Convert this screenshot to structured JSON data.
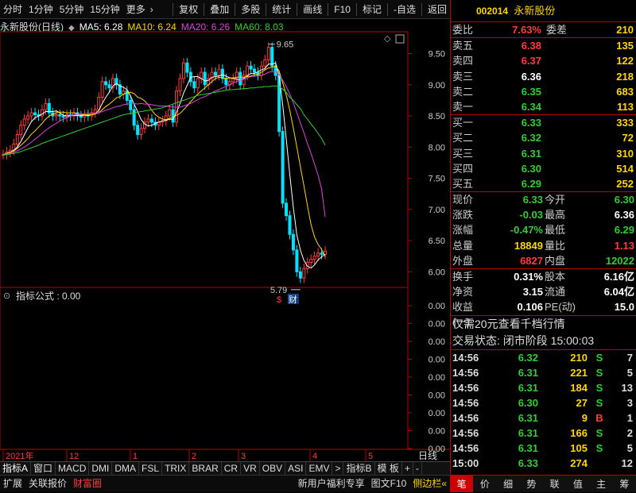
{
  "toolbar": {
    "items": [
      "分时",
      "1分钟",
      "5分钟",
      "15分钟",
      "更多"
    ],
    "more_arrow": "›",
    "right": [
      "复权",
      "叠加",
      "多股",
      "统计",
      "画线",
      "F10",
      "标记",
      "-自选",
      "返回"
    ]
  },
  "chart": {
    "title": "永新股份(日线)",
    "ma": [
      {
        "label": "MA5: 6.28",
        "color": "#ffffff"
      },
      {
        "label": "MA10: 6.24",
        "color": "#ffd700"
      },
      {
        "label": "MA20: 6.26",
        "color": "#e040e0"
      },
      {
        "label": "MA60: 8.03",
        "color": "#32cd32"
      }
    ],
    "high_label": "9.65",
    "low_label": "5.79",
    "marker_s": "$",
    "marker_cai": "财",
    "indicator_label": "指标公式 : 0.00"
  },
  "chart_data": {
    "type": "candlestick",
    "y_ticks": [
      "9.50",
      "9.00",
      "8.50",
      "8.00",
      "7.50",
      "7.00",
      "6.50",
      "6.00"
    ],
    "ylim": [
      5.75,
      9.85
    ],
    "indicator_ticks": [
      "0.00",
      "0.00",
      "0.00",
      "0.00",
      "0.00",
      "0.00",
      "0.00",
      "0.00",
      "0.00"
    ],
    "x_labels": [
      "2021年",
      "12",
      "1",
      "2",
      "3",
      "4",
      "5"
    ],
    "right_axis_label": "日线",
    "close": [
      7.88,
      7.92,
      7.95,
      8.05,
      8.2,
      8.35,
      8.45,
      8.5,
      8.55,
      8.52,
      8.5,
      8.6,
      8.7,
      8.55,
      8.5,
      8.52,
      8.5,
      8.48,
      8.52,
      8.5,
      8.55,
      8.5,
      8.48,
      8.52,
      8.5,
      8.55,
      8.6,
      8.8,
      9.05,
      9.0,
      8.95,
      9.1,
      9.0,
      8.85,
      8.9,
      8.75,
      8.6,
      8.35,
      8.2,
      8.3,
      8.4,
      8.45,
      8.4,
      8.35,
      8.4,
      8.42,
      8.5,
      8.6,
      8.4,
      8.9,
      9.1,
      9.35,
      9.2,
      9.05,
      8.95,
      9.1,
      9.2,
      9.0,
      9.1,
      9.2,
      9.15,
      9.25,
      9.1,
      9.0,
      9.05,
      9.1,
      9.2,
      9.0,
      9.15,
      9.3,
      9.25,
      9.2,
      9.15,
      9.3,
      9.4,
      9.6,
      9.3,
      9.15,
      8.25,
      7.1,
      6.9,
      6.6,
      6.35,
      6.0,
      5.9,
      6.05,
      6.15,
      6.2,
      6.25,
      6.3,
      6.28,
      6.33
    ],
    "ma_series": {
      "ma5": [
        7.88,
        7.9,
        7.92,
        7.95,
        8.0,
        8.09,
        8.2,
        8.31,
        8.41,
        8.47,
        8.5,
        8.53,
        8.57,
        8.57,
        8.57,
        8.58,
        8.55,
        8.51,
        8.5,
        8.5,
        8.51,
        8.51,
        8.51,
        8.51,
        8.51,
        8.52,
        8.53,
        8.59,
        8.7,
        8.8,
        8.88,
        8.98,
        9.02,
        8.98,
        8.96,
        8.92,
        8.82,
        8.69,
        8.57,
        8.44,
        8.37,
        8.34,
        8.35,
        8.38,
        8.4,
        8.42,
        8.43,
        8.45,
        8.44,
        8.56,
        8.7,
        8.87,
        8.99,
        9.12,
        9.13,
        9.13,
        9.1,
        9.06,
        9.07,
        9.12,
        9.13,
        9.14,
        9.16,
        9.14,
        9.11,
        9.1,
        9.09,
        9.07,
        9.1,
        9.15,
        9.18,
        9.18,
        9.21,
        9.24,
        9.26,
        9.33,
        9.33,
        9.35,
        9.14,
        8.68,
        8.14,
        7.56,
        7.04,
        6.59,
        6.35,
        6.18,
        6.09,
        6.06,
        6.11,
        6.19,
        6.24,
        6.28
      ],
      "ma10": [
        7.88,
        7.9,
        7.92,
        7.94,
        7.98,
        8.03,
        8.08,
        8.14,
        8.21,
        8.26,
        8.32,
        8.38,
        8.45,
        8.5,
        8.53,
        8.55,
        8.56,
        8.56,
        8.55,
        8.55,
        8.55,
        8.54,
        8.52,
        8.52,
        8.52,
        8.52,
        8.53,
        8.55,
        8.6,
        8.65,
        8.69,
        8.74,
        8.79,
        8.81,
        8.85,
        8.87,
        8.88,
        8.86,
        8.8,
        8.78,
        8.74,
        8.68,
        8.59,
        8.52,
        8.48,
        8.45,
        8.44,
        8.46,
        8.48,
        8.51,
        8.54,
        8.6,
        8.66,
        8.73,
        8.79,
        8.85,
        8.9,
        8.95,
        9.0,
        9.05,
        9.1,
        9.12,
        9.11,
        9.1,
        9.11,
        9.11,
        9.12,
        9.12,
        9.12,
        9.13,
        9.14,
        9.16,
        9.17,
        9.2,
        9.24,
        9.27,
        9.28,
        9.3,
        9.22,
        9.03,
        8.84,
        8.59,
        8.31,
        8.0,
        7.69,
        7.38,
        7.06,
        6.76,
        6.56,
        6.44,
        6.36,
        6.24
      ],
      "ma20": [
        7.88,
        7.89,
        7.9,
        7.92,
        7.94,
        7.97,
        8.0,
        8.04,
        8.08,
        8.13,
        8.17,
        8.22,
        8.27,
        8.31,
        8.35,
        8.38,
        8.42,
        8.45,
        8.47,
        8.5,
        8.52,
        8.53,
        8.53,
        8.54,
        8.54,
        8.54,
        8.54,
        8.55,
        8.57,
        8.59,
        8.61,
        8.63,
        8.65,
        8.66,
        8.68,
        8.69,
        8.7,
        8.7,
        8.69,
        8.7,
        8.69,
        8.69,
        8.68,
        8.67,
        8.66,
        8.66,
        8.66,
        8.65,
        8.64,
        8.64,
        8.64,
        8.66,
        8.68,
        8.7,
        8.73,
        8.76,
        8.79,
        8.81,
        8.84,
        8.87,
        8.9,
        8.92,
        8.95,
        8.97,
        9.0,
        9.03,
        9.05,
        9.07,
        9.09,
        9.11,
        9.13,
        9.14,
        9.14,
        9.15,
        9.17,
        9.2,
        9.21,
        9.21,
        9.16,
        9.07,
        8.97,
        8.85,
        8.71,
        8.55,
        8.39,
        8.23,
        8.06,
        7.9,
        7.73,
        7.55,
        7.33,
        6.88
      ],
      "ma60": [
        7.88,
        7.88,
        7.89,
        7.9,
        7.91,
        7.93,
        7.95,
        7.97,
        7.99,
        8.01,
        8.03,
        8.06,
        8.08,
        8.1,
        8.12,
        8.14,
        8.16,
        8.18,
        8.2,
        8.22,
        8.24,
        8.26,
        8.28,
        8.3,
        8.32,
        8.34,
        8.36,
        8.38,
        8.4,
        8.42,
        8.44,
        8.46,
        8.48,
        8.5,
        8.52,
        8.53,
        8.54,
        8.55,
        8.56,
        8.57,
        8.58,
        8.59,
        8.6,
        8.61,
        8.62,
        8.63,
        8.65,
        8.67,
        8.69,
        8.71,
        8.73,
        8.75,
        8.77,
        8.79,
        8.81,
        8.83,
        8.84,
        8.85,
        8.86,
        8.87,
        8.88,
        8.89,
        8.9,
        8.91,
        8.92,
        8.92,
        8.93,
        8.93,
        8.94,
        8.94,
        8.95,
        8.95,
        8.96,
        8.96,
        8.97,
        8.97,
        8.98,
        8.98,
        8.97,
        8.93,
        8.88,
        8.8,
        8.75,
        8.68,
        8.62,
        8.52,
        8.45,
        8.37,
        8.3,
        8.22,
        8.14,
        8.03
      ]
    }
  },
  "quote": {
    "code": "002014",
    "name": "永新股份",
    "weibi_label": "委比",
    "weibi": "7.63%",
    "weicha_label": "委差",
    "weicha": "210",
    "sells": [
      {
        "l": "卖五",
        "p": "6.38",
        "v": "135",
        "c": "red"
      },
      {
        "l": "卖四",
        "p": "6.37",
        "v": "122",
        "c": "red"
      },
      {
        "l": "卖三",
        "p": "6.36",
        "v": "218",
        "c": "white"
      },
      {
        "l": "卖二",
        "p": "6.35",
        "v": "683",
        "c": "green"
      },
      {
        "l": "卖一",
        "p": "6.34",
        "v": "113",
        "c": "green"
      }
    ],
    "buys": [
      {
        "l": "买一",
        "p": "6.33",
        "v": "333",
        "c": "green"
      },
      {
        "l": "买二",
        "p": "6.32",
        "v": "72",
        "c": "green"
      },
      {
        "l": "买三",
        "p": "6.31",
        "v": "310",
        "c": "green"
      },
      {
        "l": "买四",
        "p": "6.30",
        "v": "514",
        "c": "green"
      },
      {
        "l": "买五",
        "p": "6.29",
        "v": "252",
        "c": "green"
      }
    ],
    "stats": [
      {
        "l": "现价",
        "v": "6.33",
        "c": "green",
        "l2": "今开",
        "v2": "6.30",
        "c2": "green"
      },
      {
        "l": "涨跌",
        "v": "-0.03",
        "c": "green",
        "l2": "最高",
        "v2": "6.36",
        "c2": "white"
      },
      {
        "l": "涨幅",
        "v": "-0.47%",
        "c": "green",
        "l2": "最低",
        "v2": "6.29",
        "c2": "green"
      },
      {
        "l": "总量",
        "v": "18849",
        "c": "yellow",
        "l2": "量比",
        "v2": "1.13",
        "c2": "red"
      },
      {
        "l": "外盘",
        "v": "6827",
        "c": "red",
        "l2": "内盘",
        "v2": "12022",
        "c2": "green"
      }
    ],
    "extra": [
      {
        "l": "换手",
        "v": "0.31%",
        "l2": "股本",
        "v2": "6.16亿"
      },
      {
        "l": "净资",
        "v": "3.15",
        "l2": "流通",
        "v2": "6.04亿"
      },
      {
        "l": "收益(一)",
        "v": "0.106",
        "l2": "PE(动)",
        "v2": "15.0"
      }
    ],
    "promo": "仅需20元查看千档行情",
    "state": "交易状态: 闭市阶段  15:00:03",
    "ticks": [
      {
        "t": "14:56",
        "p": "6.32",
        "v": "210",
        "d": "S",
        "n": "7",
        "dc": "green"
      },
      {
        "t": "14:56",
        "p": "6.31",
        "v": "221",
        "d": "S",
        "n": "5",
        "dc": "green"
      },
      {
        "t": "14:56",
        "p": "6.31",
        "v": "184",
        "d": "S",
        "n": "13",
        "dc": "green"
      },
      {
        "t": "14:56",
        "p": "6.30",
        "v": "27",
        "d": "S",
        "n": "3",
        "dc": "green"
      },
      {
        "t": "14:56",
        "p": "6.31",
        "v": "9",
        "d": "B",
        "n": "1",
        "dc": "red"
      },
      {
        "t": "14:56",
        "p": "6.31",
        "v": "166",
        "d": "S",
        "n": "2",
        "dc": "green"
      },
      {
        "t": "14:56",
        "p": "6.31",
        "v": "105",
        "d": "S",
        "n": "5",
        "dc": "green"
      },
      {
        "t": "15:00",
        "p": "6.33",
        "v": "274",
        "d": "",
        "n": "12",
        "dc": "green"
      }
    ]
  },
  "bottom": {
    "tabs1": [
      "指标A",
      "窗口",
      "MACD",
      "DMI",
      "DMA",
      "FSL",
      "TRIX",
      "BRAR",
      "CR",
      "VR",
      "OBV",
      "ASI",
      "EMV",
      ">",
      "指标B",
      "模 板",
      "+",
      "-"
    ],
    "tabs2": [
      "扩展",
      "关联报价",
      "财富圈"
    ],
    "promo2": "新用户福利专享",
    "f10": "图文F10",
    "side": "侧边栏«"
  },
  "footer_tabs": [
    "笔",
    "价",
    "细",
    "势",
    "联",
    "值",
    "主",
    "筹"
  ]
}
